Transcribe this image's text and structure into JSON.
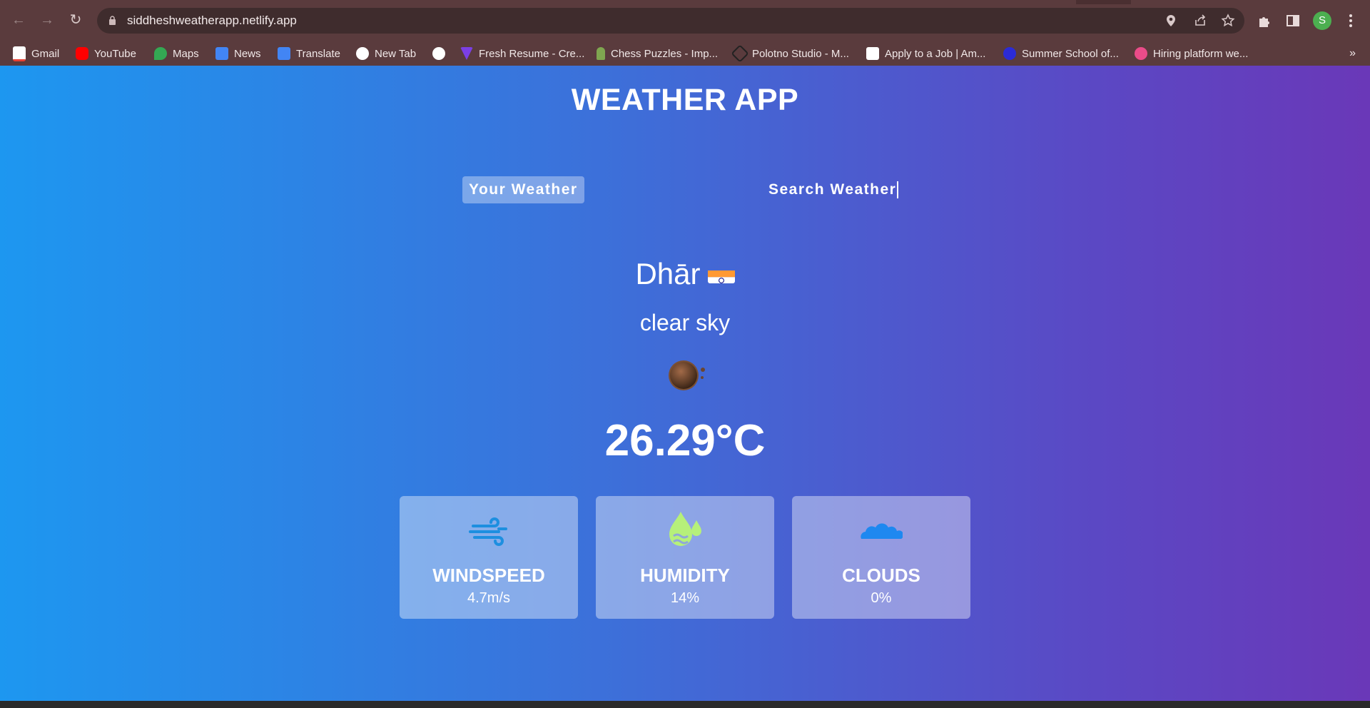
{
  "browser": {
    "url": "siddheshweatherapp.netlify.app",
    "profile_initial": "S",
    "bookmarks": [
      {
        "label": "Gmail",
        "color": "#ea4335"
      },
      {
        "label": "YouTube",
        "color": "#ff0000"
      },
      {
        "label": "Maps",
        "color": "#34a853"
      },
      {
        "label": "News",
        "color": "#4285f4"
      },
      {
        "label": "Translate",
        "color": "#4285f4"
      },
      {
        "label": "New Tab",
        "color": "#ffffff"
      },
      {
        "label": "",
        "color": "#ffffff"
      },
      {
        "label": "Fresh Resume - Cre...",
        "color": "#7b3fe4"
      },
      {
        "label": "Chess Puzzles - Imp...",
        "color": "#7fa650"
      },
      {
        "label": "Polotno Studio - M...",
        "color": "#222222"
      },
      {
        "label": "Apply to a Job | Am...",
        "color": "#ffffff"
      },
      {
        "label": "Summer School of...",
        "color": "#2b2bd6"
      },
      {
        "label": "Hiring platform we...",
        "color": "#ea4c89"
      }
    ],
    "more": "»"
  },
  "app": {
    "title": "WEATHER APP",
    "tabs": {
      "your_weather": "Your Weather",
      "search_weather": "Search Weather"
    },
    "city": "Dhār",
    "description": "clear sky",
    "temperature": "26.29°C",
    "cards": {
      "windspeed": {
        "label": "WINDSPEED",
        "value": "4.7m/s"
      },
      "humidity": {
        "label": "HUMIDITY",
        "value": "14%"
      },
      "clouds": {
        "label": "CLOUDS",
        "value": "0%"
      }
    }
  }
}
